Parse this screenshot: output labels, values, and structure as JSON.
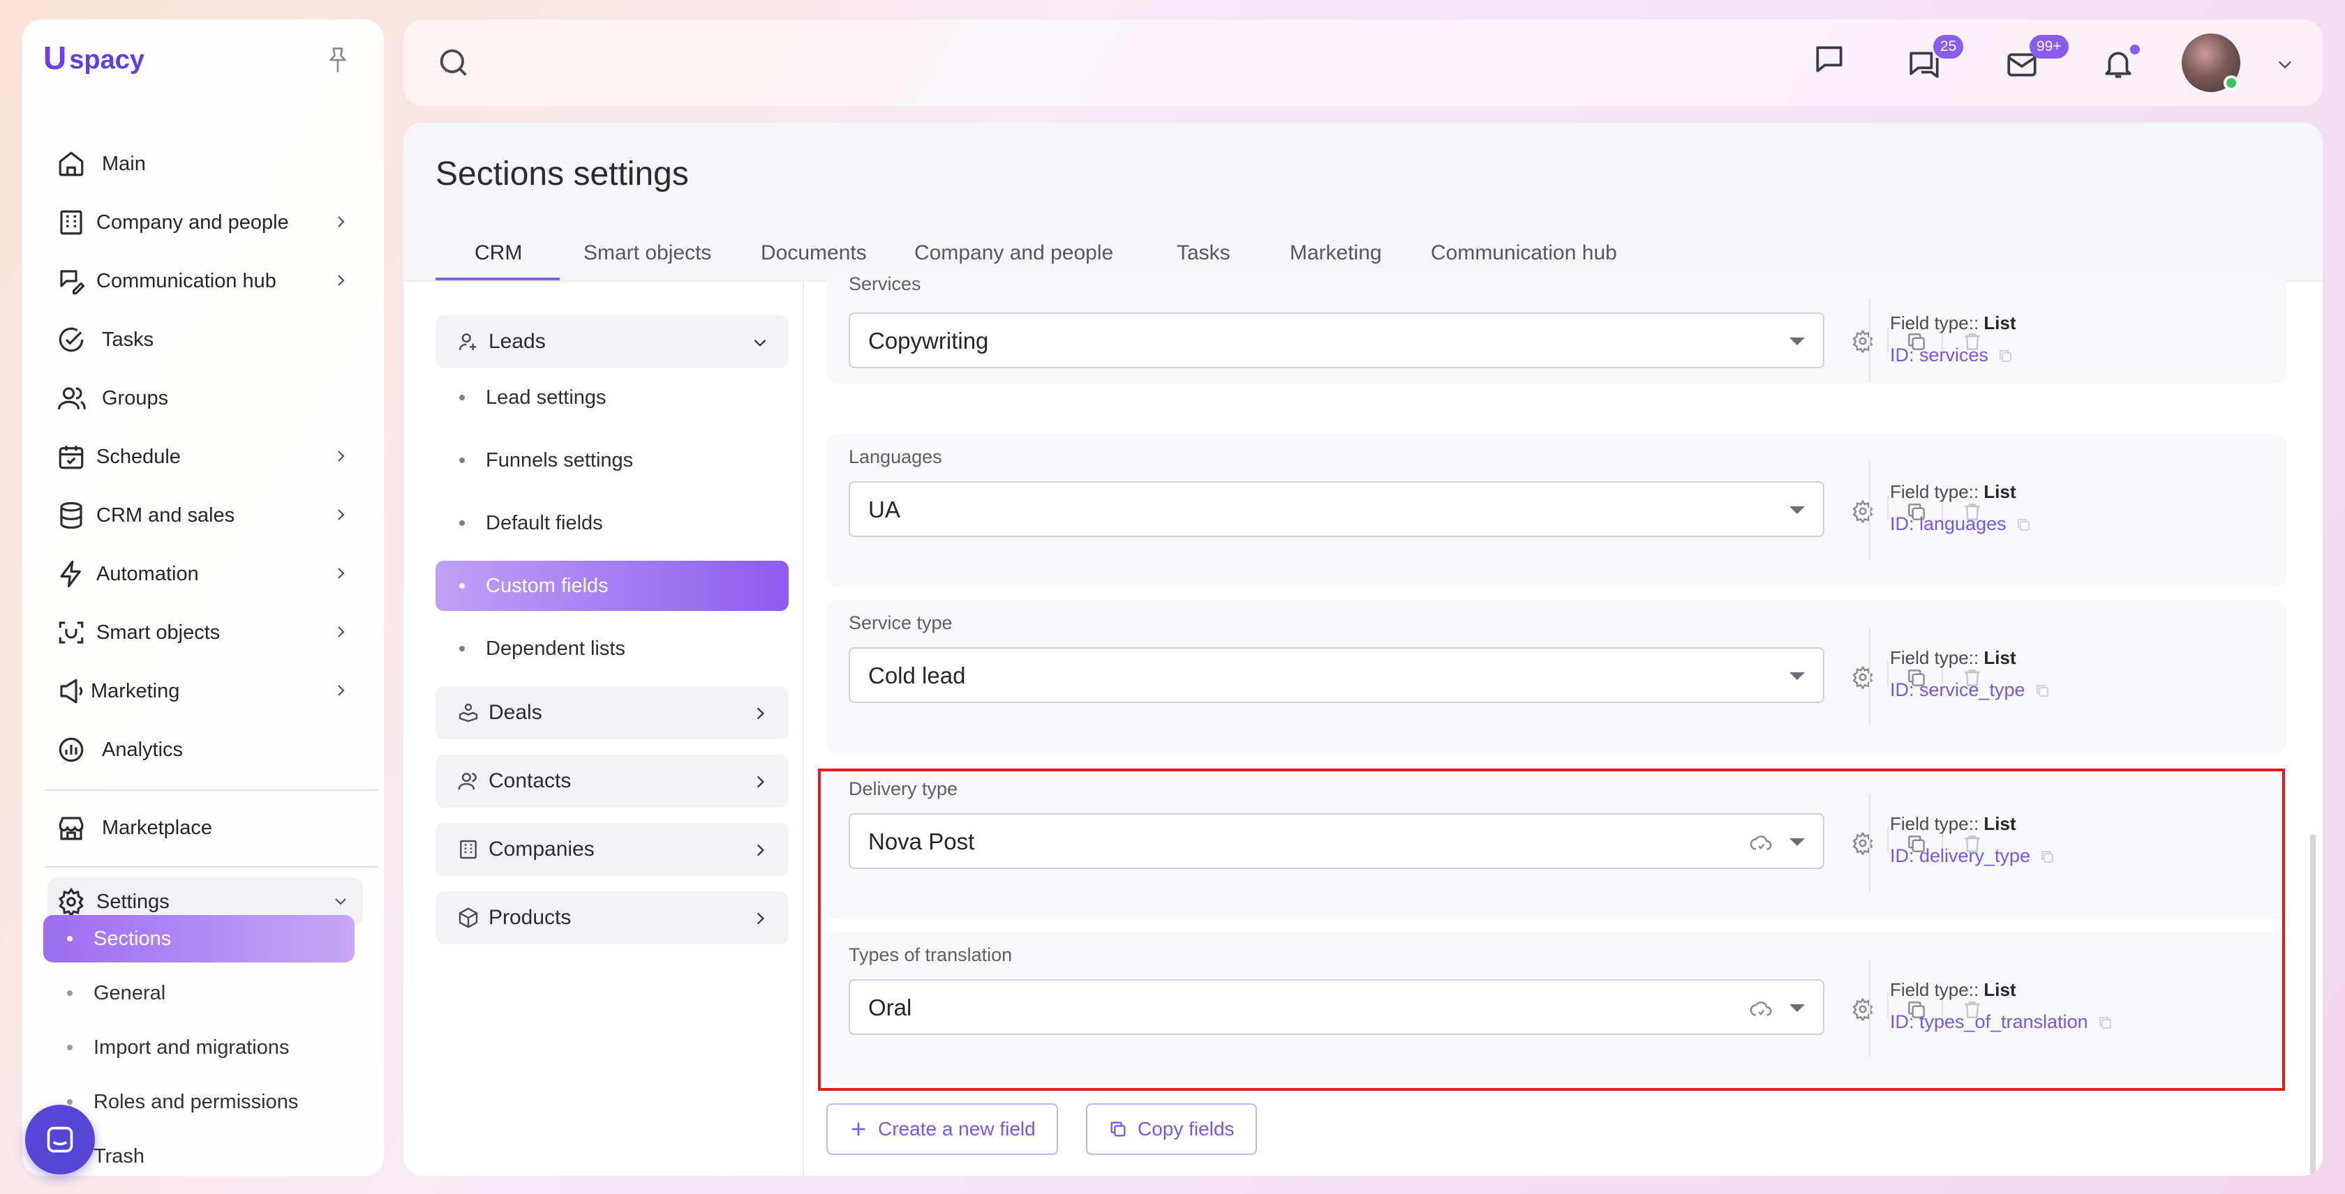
{
  "app": {
    "logo_letter": "U",
    "logo_text": "spacy",
    "brand_color": "#6b3ff0",
    "accent_color": "#8a5cf0",
    "highlight_color": "#e01b24"
  },
  "sidebar": {
    "items": [
      {
        "label": "Main",
        "icon": "home-icon"
      },
      {
        "label": "Company and people",
        "icon": "building-icon"
      },
      {
        "label": "Communication hub",
        "icon": "chat-edit-icon"
      },
      {
        "label": "Tasks",
        "icon": "check-circle-icon"
      },
      {
        "label": "Groups",
        "icon": "users-icon"
      },
      {
        "label": "Schedule",
        "icon": "calendar-icon"
      },
      {
        "label": "CRM and sales",
        "icon": "database-icon"
      },
      {
        "label": "Automation",
        "icon": "lightning-icon"
      },
      {
        "label": "Smart objects",
        "icon": "scan-icon"
      },
      {
        "label": "Marketing",
        "icon": "megaphone-icon"
      },
      {
        "label": "Analytics",
        "icon": "pie-chart-icon"
      },
      {
        "label": "Marketplace",
        "icon": "store-icon"
      },
      {
        "label": "Settings",
        "icon": "gear-icon"
      }
    ],
    "settings_sub": [
      "Sections",
      "General",
      "Import and migrations",
      "Roles and permissions",
      "Trash"
    ]
  },
  "topbar": {
    "chat_badge": "25",
    "mail_badge": "99+"
  },
  "page": {
    "title": "Sections settings",
    "tabs": [
      "CRM",
      "Smart objects",
      "Documents",
      "Company and people",
      "Tasks",
      "Marketing",
      "Communication hub"
    ],
    "active_tab": "CRM"
  },
  "left_menu": {
    "leads": "Leads",
    "leads_sub": [
      "Lead settings",
      "Funnels settings",
      "Default fields",
      "Custom fields",
      "Dependent lists"
    ],
    "groups": [
      "Deals",
      "Contacts",
      "Companies",
      "Products"
    ]
  },
  "fields": [
    {
      "label": "Services",
      "value": "Copywriting",
      "type_label": "Field type::",
      "type": "List",
      "id": "ID: services"
    },
    {
      "label": "Languages",
      "value": "UA",
      "type_label": "Field type::",
      "type": "List",
      "id": "ID: languages"
    },
    {
      "label": "Service type",
      "value": "Cold lead",
      "type_label": "Field type::",
      "type": "List",
      "id": "ID: service_type"
    },
    {
      "label": "Delivery type",
      "value": "Nova Post",
      "type_label": "Field type::",
      "type": "List",
      "id": "ID: delivery_type"
    },
    {
      "label": "Types of translation",
      "value": "Oral",
      "type_label": "Field type::",
      "type": "List",
      "id": "ID: types_of_translation"
    }
  ],
  "actions": {
    "create": "Create a new field",
    "copy": "Copy fields"
  }
}
